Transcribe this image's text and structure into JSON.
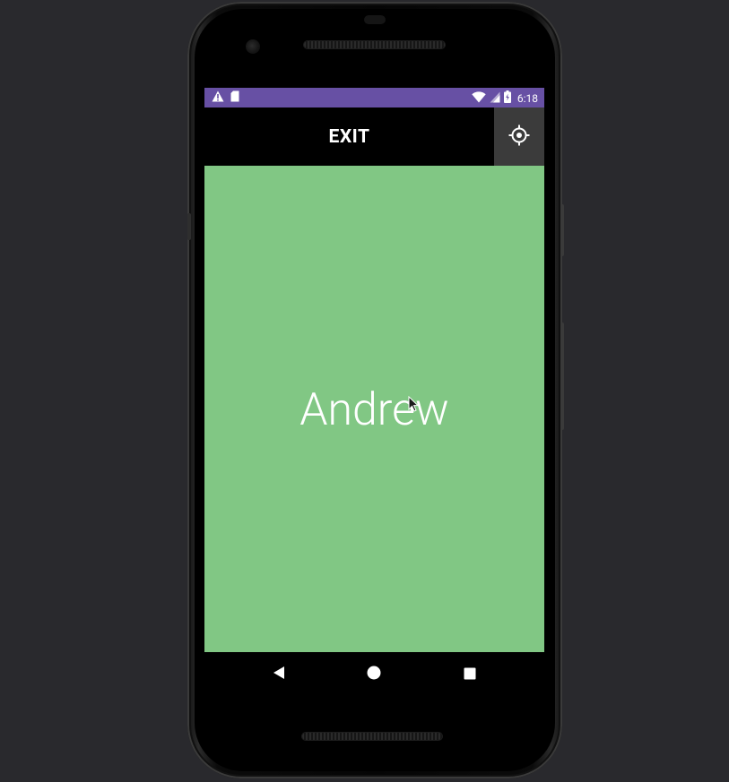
{
  "colors": {
    "status_bar": "#6750a4",
    "content_background": "#81c784",
    "settings_button_background": "#3b3b3b",
    "text": "#ffffff"
  },
  "status_bar": {
    "left_icons": [
      "warning-icon",
      "sd-card-icon"
    ],
    "right_icons": [
      "wifi-icon",
      "cell-signal-icon",
      "battery-charging-icon"
    ],
    "time": "6:18"
  },
  "toolbar": {
    "exit_label": "EXIT",
    "settings_icon": "settings-target-icon"
  },
  "main": {
    "name": "Andrew"
  },
  "nav": {
    "icons": [
      "back-icon",
      "home-icon",
      "recents-icon"
    ]
  }
}
